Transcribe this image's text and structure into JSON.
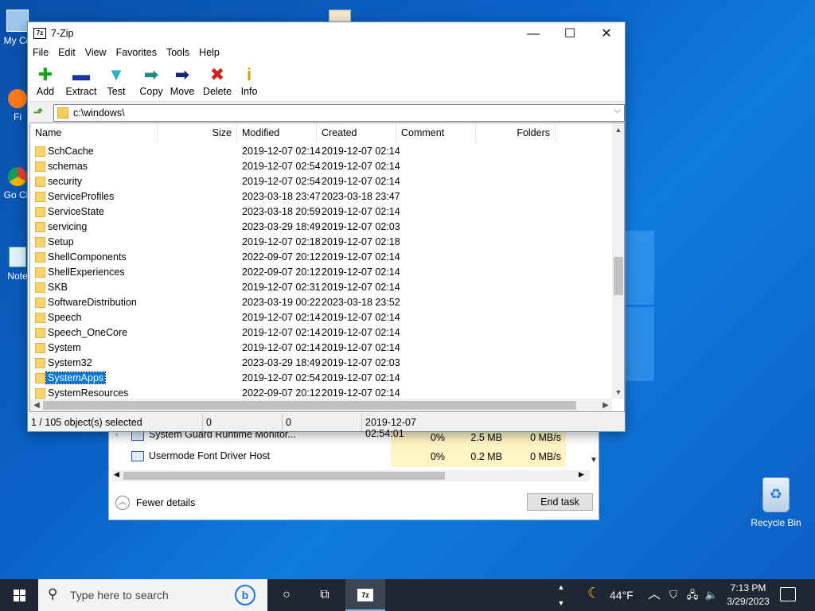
{
  "desktop": {
    "icon_labels": [
      "My Co",
      "Fi",
      "Go Ch",
      "Note"
    ],
    "recycle_bin": "Recycle Bin"
  },
  "task_manager": {
    "rows": [
      {
        "name": "System Guard Runtime Monitor...",
        "cpu": "0%",
        "memory": "2.5 MB",
        "disk": "0 MB/s"
      },
      {
        "name": "Usermode Font Driver Host",
        "cpu": "0%",
        "memory": "0.2 MB",
        "disk": "0 MB/s"
      }
    ],
    "fewer_details": "Fewer details",
    "end_task": "End task"
  },
  "window": {
    "app_icon": "7z",
    "title": "7-Zip",
    "controls": {
      "minimize": "—",
      "maximize": "☐",
      "close": "✕"
    },
    "menu": [
      "File",
      "Edit",
      "View",
      "Favorites",
      "Tools",
      "Help"
    ],
    "toolbar": [
      {
        "label": "Add",
        "icon": "plus-icon",
        "glyph": "✚",
        "color": "#1aa51a"
      },
      {
        "label": "Extract",
        "icon": "minus-icon",
        "glyph": "▬",
        "color": "#1b2fa8"
      },
      {
        "label": "Test",
        "icon": "check-icon",
        "glyph": "▼",
        "color": "#2bb4c8"
      },
      {
        "label": "Copy",
        "icon": "arrow-copy-icon",
        "glyph": "➡",
        "color": "#1f8a86"
      },
      {
        "label": "Move",
        "icon": "arrow-move-icon",
        "glyph": "➡",
        "color": "#1a237e"
      },
      {
        "label": "Delete",
        "icon": "delete-x-icon",
        "glyph": "✖",
        "color": "#d32020"
      },
      {
        "label": "Info",
        "icon": "info-icon",
        "glyph": "i",
        "color": "#c9a300"
      }
    ],
    "address": "c:\\windows\\",
    "columns": [
      "Name",
      "Size",
      "Modified",
      "Created",
      "Comment",
      "Folders"
    ],
    "rows": [
      {
        "name": "SchCache",
        "modified": "2019-12-07 02:14",
        "created": "2019-12-07 02:14"
      },
      {
        "name": "schemas",
        "modified": "2019-12-07 02:54",
        "created": "2019-12-07 02:14"
      },
      {
        "name": "security",
        "modified": "2019-12-07 02:54",
        "created": "2019-12-07 02:14"
      },
      {
        "name": "ServiceProfiles",
        "modified": "2023-03-18 23:47",
        "created": "2023-03-18 23:47"
      },
      {
        "name": "ServiceState",
        "modified": "2023-03-18 20:59",
        "created": "2019-12-07 02:14"
      },
      {
        "name": "servicing",
        "modified": "2023-03-29 18:49",
        "created": "2019-12-07 02:03"
      },
      {
        "name": "Setup",
        "modified": "2019-12-07 02:18",
        "created": "2019-12-07 02:18"
      },
      {
        "name": "ShellComponents",
        "modified": "2022-09-07 20:12",
        "created": "2019-12-07 02:14"
      },
      {
        "name": "ShellExperiences",
        "modified": "2022-09-07 20:12",
        "created": "2019-12-07 02:14"
      },
      {
        "name": "SKB",
        "modified": "2019-12-07 02:31",
        "created": "2019-12-07 02:14"
      },
      {
        "name": "SoftwareDistribution",
        "modified": "2023-03-19 00:22",
        "created": "2023-03-18 23:52"
      },
      {
        "name": "Speech",
        "modified": "2019-12-07 02:14",
        "created": "2019-12-07 02:14"
      },
      {
        "name": "Speech_OneCore",
        "modified": "2019-12-07 02:14",
        "created": "2019-12-07 02:14"
      },
      {
        "name": "System",
        "modified": "2019-12-07 02:14",
        "created": "2019-12-07 02:14"
      },
      {
        "name": "System32",
        "modified": "2023-03-29 18:49",
        "created": "2019-12-07 02:03"
      },
      {
        "name": "SystemApps",
        "modified": "2019-12-07 02:54",
        "created": "2019-12-07 02:14",
        "selected": true
      },
      {
        "name": "SystemResources",
        "modified": "2022-09-07 20:12",
        "created": "2019-12-07 02:14"
      }
    ],
    "status": {
      "selection": "1 / 105 object(s) selected",
      "size": "0",
      "packed": "0",
      "date": "2019-12-07 02:54:01"
    }
  },
  "taskbar": {
    "search_placeholder": "Type here to search",
    "weather": "44°F",
    "time": "7:13 PM",
    "date": "3/29/2023"
  }
}
